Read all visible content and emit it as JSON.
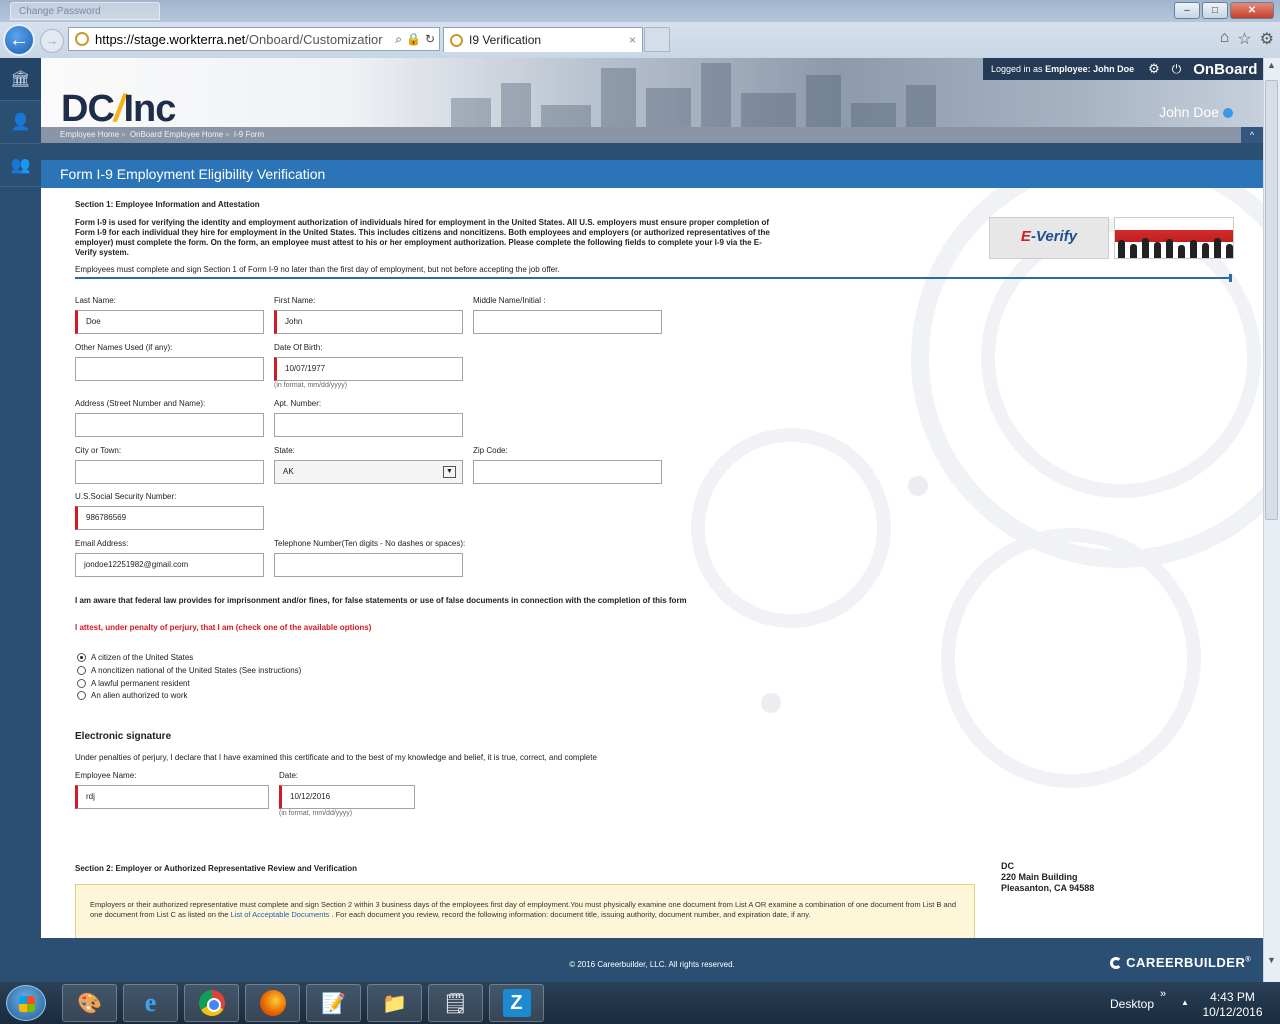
{
  "browser": {
    "ghost_tab_title": "Change Password",
    "url_host": "https://stage.workterra.net",
    "url_path": "/Onboard/Customizatior",
    "tab_title": "I9 Verification",
    "tab_close": "×",
    "window_buttons": [
      "–",
      "□",
      "✕"
    ]
  },
  "header": {
    "logo_part1": "DC",
    "logo_part2": "Inc",
    "logged_in_label": "Logged in as",
    "role": "Employee:",
    "user": "John Doe",
    "brand": "OnBoard",
    "display_name": "John Doe",
    "breadcrumb": [
      "Employee Home",
      "OnBoard Employee Home",
      "I-9 Form"
    ],
    "breadcrumb_sep": "»"
  },
  "page": {
    "title": "Form I-9 Employment Eligibility Verification"
  },
  "section1": {
    "title": "Section 1: Employee Information and Attestation",
    "intro": "Form I-9 is used for verifying the identity and employment authorization of individuals hired for employment in the United States. All U.S. employers must ensure proper completion of Form I-9 for each individual they hire for employment in the United States. This includes citizens and noncitizens. Both employees and employers (or authorized representatives of the employer) must complete the form. On the form, an employee must attest to his or her employment authorization. Please complete the following fields to complete your I-9 via the E-Verify system.",
    "deadline_note": "Employees must complete and sign Section 1 of Form I-9 no later than the first day of employment, but not before accepting the job offer.",
    "everify_e": "E",
    "everify_text": "-Verify"
  },
  "form": {
    "last_name": {
      "label": "Last Name:",
      "value": "Doe"
    },
    "first_name": {
      "label": "First Name:",
      "value": "John"
    },
    "middle_name": {
      "label": "Middle Name/Initial :",
      "value": ""
    },
    "other_names": {
      "label": "Other Names Used (if any):",
      "value": ""
    },
    "dob": {
      "label": "Date Of Birth:",
      "value": "10/07/1977",
      "hint": "(in format, mm/dd/yyyy)"
    },
    "address": {
      "label": "Address (Street Number and Name):",
      "value": ""
    },
    "apt": {
      "label": "Apt. Number:",
      "value": ""
    },
    "city": {
      "label": "City or Town:",
      "value": ""
    },
    "state": {
      "label": "State:",
      "value": "AK"
    },
    "zip": {
      "label": "Zip Code:",
      "value": ""
    },
    "ssn": {
      "label": "U.S.Social Security Number:",
      "value": "986786569"
    },
    "email": {
      "label": "Email Address:",
      "value": "jondoe12251982@gmail.com"
    },
    "phone": {
      "label": "Telephone Number(Ten digits - No dashes or spaces):",
      "value": ""
    }
  },
  "attestation": {
    "aware": "I am aware that federal law provides for imprisonment and/or fines, for false statements or use of false documents in connection with the completion of this form",
    "attest": "I attest, under penalty of perjury, that I am (check one of the available options)",
    "options": [
      "A citizen of the United States",
      "A noncitizen national of the United States (See instructions)",
      "A lawful permanent resident",
      "An alien authorized to work"
    ],
    "selected_index": 0
  },
  "signature": {
    "title": "Electronic signature",
    "text": "Under penalties of perjury, I declare that I have examined this certificate and to the best of my knowledge and belief, it is true, correct, and complete",
    "name_label": "Employee Name:",
    "name_value": "rdj",
    "date_label": "Date:",
    "date_value": "10/12/2016",
    "date_hint": "(in format, mm/dd/yyyy)"
  },
  "section2": {
    "title": "Section 2: Employer or Authorized Representative Review and Verification",
    "notice_before": "Employers or their authorized representative must complete and sign Section 2 within 3 business days of the employees first day of employment.You must physically examine one document from List A OR examine a combination of one document from List B and one document from List C as listed on the ",
    "notice_link": "List of Acceptable Documents",
    "notice_after": " . For each document you review, record the following information: document title, issuing authority, document number, and expiration date, if any.",
    "employer_name": "DC",
    "employer_address1": "220 Main Building",
    "employer_address2": "Pleasanton, CA  94588"
  },
  "footer": {
    "copyright": "© 2016 Careerbuilder, LLC. All rights reserved.",
    "cb_logo": "CAREERBUILDER",
    "cb_reg": "®"
  },
  "taskbar": {
    "desktop": "Desktop",
    "chevrons": "»",
    "time": "4:43 PM",
    "date": "10/12/2016"
  },
  "colors": {
    "nav_blue": "#2b4e73",
    "title_blue": "#2c74b8",
    "required_red": "#d11b22",
    "notice_bg": "#fdf6d8"
  }
}
